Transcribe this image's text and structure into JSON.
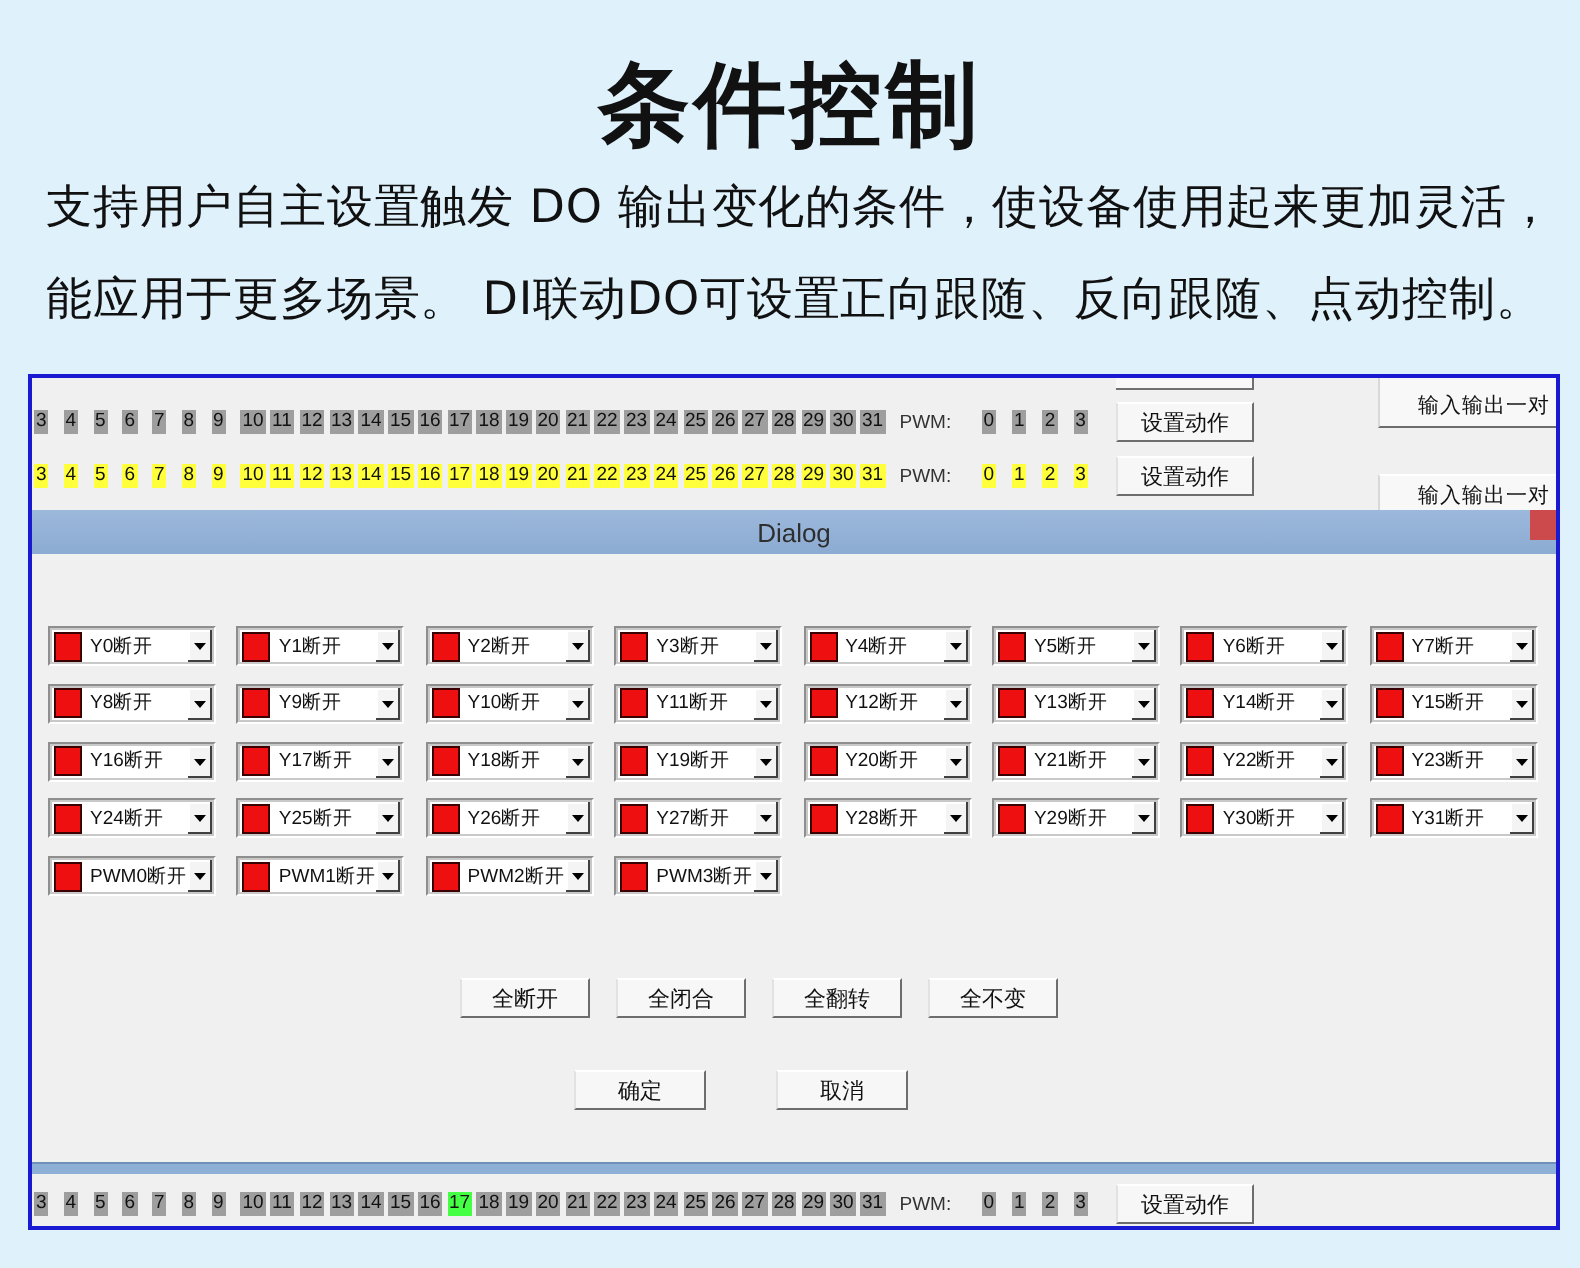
{
  "heading": {
    "title": "条件控制",
    "description": [
      "支持用户自主设置触发 DO 输出变化的条件，使设备使用起来更加灵活，",
      "能应用于更多场景。 DI联动DO可设置正向跟随、反向跟随、点动控制。"
    ]
  },
  "top_panel": {
    "bit_rows": [
      {
        "bits": [
          {
            "label": "3",
            "color": "#9e9e9e"
          },
          {
            "label": "4",
            "color": "#9e9e9e"
          },
          {
            "label": "5",
            "color": "#9e9e9e"
          },
          {
            "label": "6",
            "color": "#9e9e9e"
          },
          {
            "label": "7",
            "color": "#9e9e9e"
          },
          {
            "label": "8",
            "color": "#9e9e9e"
          },
          {
            "label": "9",
            "color": "#9e9e9e"
          },
          {
            "label": "10",
            "color": "#9e9e9e"
          },
          {
            "label": "11",
            "color": "#9e9e9e"
          },
          {
            "label": "12",
            "color": "#9e9e9e"
          },
          {
            "label": "13",
            "color": "#9e9e9e"
          },
          {
            "label": "14",
            "color": "#9e9e9e"
          },
          {
            "label": "15",
            "color": "#9e9e9e"
          },
          {
            "label": "16",
            "color": "#9e9e9e"
          },
          {
            "label": "17",
            "color": "#9e9e9e"
          },
          {
            "label": "18",
            "color": "#9e9e9e"
          },
          {
            "label": "19",
            "color": "#9e9e9e"
          },
          {
            "label": "20",
            "color": "#9e9e9e"
          },
          {
            "label": "21",
            "color": "#9e9e9e"
          },
          {
            "label": "22",
            "color": "#9e9e9e"
          },
          {
            "label": "23",
            "color": "#9e9e9e"
          },
          {
            "label": "24",
            "color": "#9e9e9e"
          },
          {
            "label": "25",
            "color": "#9e9e9e"
          },
          {
            "label": "26",
            "color": "#9e9e9e"
          },
          {
            "label": "27",
            "color": "#9e9e9e"
          },
          {
            "label": "28",
            "color": "#9e9e9e"
          },
          {
            "label": "29",
            "color": "#9e9e9e"
          },
          {
            "label": "30",
            "color": "#9e9e9e"
          },
          {
            "label": "31",
            "color": "#9e9e9e"
          }
        ],
        "pwm_label": "PWM:",
        "pwm_bits": [
          {
            "label": "0",
            "color": "#9e9e9e"
          },
          {
            "label": "1",
            "color": "#9e9e9e"
          },
          {
            "label": "2",
            "color": "#9e9e9e"
          },
          {
            "label": "3",
            "color": "#9e9e9e"
          }
        ],
        "button": "设置动作"
      },
      {
        "bits": [
          {
            "label": "3",
            "color": "#ffff3c"
          },
          {
            "label": "4",
            "color": "#ffff3c"
          },
          {
            "label": "5",
            "color": "#ffff3c"
          },
          {
            "label": "6",
            "color": "#ffff3c"
          },
          {
            "label": "7",
            "color": "#ffff3c"
          },
          {
            "label": "8",
            "color": "#ffff3c"
          },
          {
            "label": "9",
            "color": "#ffff3c"
          },
          {
            "label": "10",
            "color": "#ffff3c"
          },
          {
            "label": "11",
            "color": "#ffff3c"
          },
          {
            "label": "12",
            "color": "#ffff3c"
          },
          {
            "label": "13",
            "color": "#ffff3c"
          },
          {
            "label": "14",
            "color": "#ffff3c"
          },
          {
            "label": "15",
            "color": "#ffff3c"
          },
          {
            "label": "16",
            "color": "#ffff3c"
          },
          {
            "label": "17",
            "color": "#ffff3c"
          },
          {
            "label": "18",
            "color": "#ffff3c"
          },
          {
            "label": "19",
            "color": "#ffff3c"
          },
          {
            "label": "20",
            "color": "#ffff3c"
          },
          {
            "label": "21",
            "color": "#ffff3c"
          },
          {
            "label": "22",
            "color": "#ffff3c"
          },
          {
            "label": "23",
            "color": "#ffff3c"
          },
          {
            "label": "24",
            "color": "#ffff3c"
          },
          {
            "label": "25",
            "color": "#ffff3c"
          },
          {
            "label": "26",
            "color": "#ffff3c"
          },
          {
            "label": "27",
            "color": "#ffff3c"
          },
          {
            "label": "28",
            "color": "#ffff3c"
          },
          {
            "label": "29",
            "color": "#ffff3c"
          },
          {
            "label": "30",
            "color": "#ffff3c"
          },
          {
            "label": "31",
            "color": "#ffff3c"
          }
        ],
        "pwm_label": "PWM:",
        "pwm_bits": [
          {
            "label": "0",
            "color": "#ffff3c"
          },
          {
            "label": "1",
            "color": "#ffff3c"
          },
          {
            "label": "2",
            "color": "#ffff3c"
          },
          {
            "label": "3",
            "color": "#ffff3c"
          }
        ],
        "button": "设置动作"
      }
    ],
    "side_buttons": [
      "输入输出一对",
      "输入输出一对"
    ]
  },
  "dialog": {
    "title": "Dialog",
    "outputs": [
      "Y0断开",
      "Y1断开",
      "Y2断开",
      "Y3断开",
      "Y4断开",
      "Y5断开",
      "Y6断开",
      "Y7断开",
      "Y8断开",
      "Y9断开",
      "Y10断开",
      "Y11断开",
      "Y12断开",
      "Y13断开",
      "Y14断开",
      "Y15断开",
      "Y16断开",
      "Y17断开",
      "Y18断开",
      "Y19断开",
      "Y20断开",
      "Y21断开",
      "Y22断开",
      "Y23断开",
      "Y24断开",
      "Y25断开",
      "Y26断开",
      "Y27断开",
      "Y28断开",
      "Y29断开",
      "Y30断开",
      "Y31断开",
      "PWM0断开",
      "PWM1断开",
      "PWM2断开",
      "PWM3断开"
    ],
    "bulk_buttons": [
      "全断开",
      "全闭合",
      "全翻转",
      "全不变"
    ],
    "buttons": [
      "确定",
      "取消"
    ]
  },
  "bottom_panel": {
    "bits": [
      {
        "label": "3",
        "color": "#9e9e9e"
      },
      {
        "label": "4",
        "color": "#9e9e9e"
      },
      {
        "label": "5",
        "color": "#9e9e9e"
      },
      {
        "label": "6",
        "color": "#9e9e9e"
      },
      {
        "label": "7",
        "color": "#9e9e9e"
      },
      {
        "label": "8",
        "color": "#9e9e9e"
      },
      {
        "label": "9",
        "color": "#9e9e9e"
      },
      {
        "label": "10",
        "color": "#9e9e9e"
      },
      {
        "label": "11",
        "color": "#9e9e9e"
      },
      {
        "label": "12",
        "color": "#9e9e9e"
      },
      {
        "label": "13",
        "color": "#9e9e9e"
      },
      {
        "label": "14",
        "color": "#9e9e9e"
      },
      {
        "label": "15",
        "color": "#9e9e9e"
      },
      {
        "label": "16",
        "color": "#9e9e9e"
      },
      {
        "label": "17",
        "color": "#44ff44"
      },
      {
        "label": "18",
        "color": "#9e9e9e"
      },
      {
        "label": "19",
        "color": "#9e9e9e"
      },
      {
        "label": "20",
        "color": "#9e9e9e"
      },
      {
        "label": "21",
        "color": "#9e9e9e"
      },
      {
        "label": "22",
        "color": "#9e9e9e"
      },
      {
        "label": "23",
        "color": "#9e9e9e"
      },
      {
        "label": "24",
        "color": "#9e9e9e"
      },
      {
        "label": "25",
        "color": "#9e9e9e"
      },
      {
        "label": "26",
        "color": "#9e9e9e"
      },
      {
        "label": "27",
        "color": "#9e9e9e"
      },
      {
        "label": "28",
        "color": "#9e9e9e"
      },
      {
        "label": "29",
        "color": "#9e9e9e"
      },
      {
        "label": "30",
        "color": "#9e9e9e"
      },
      {
        "label": "31",
        "color": "#9e9e9e"
      }
    ],
    "pwm_label": "PWM:",
    "pwm_bits": [
      {
        "label": "0",
        "color": "#9e9e9e"
      },
      {
        "label": "1",
        "color": "#9e9e9e"
      },
      {
        "label": "2",
        "color": "#9e9e9e"
      },
      {
        "label": "3",
        "color": "#9e9e9e"
      }
    ],
    "button": "设置动作"
  }
}
